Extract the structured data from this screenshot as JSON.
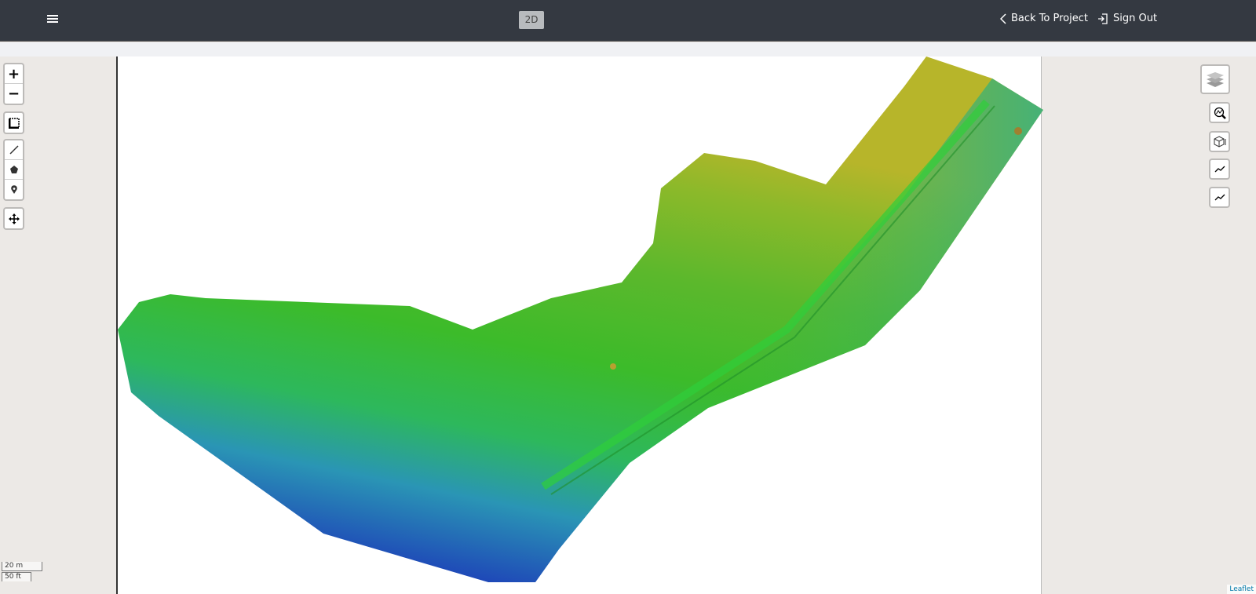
{
  "header": {
    "mode_label": "2D",
    "back_label": "Back To Project",
    "signout_label": "Sign Out"
  },
  "map": {
    "scale_metric": "20 m",
    "scale_imperial": "50 ft",
    "attribution": "Leaflet",
    "left_controls": [
      "zoom-in",
      "zoom-out",
      "fit-bounds",
      "measure-line",
      "measure-polygon",
      "marker",
      "pan"
    ],
    "right_controls": [
      "layers",
      "contour-search",
      "volume-3d",
      "elevation-profile",
      "elevation-profile-2"
    ]
  }
}
